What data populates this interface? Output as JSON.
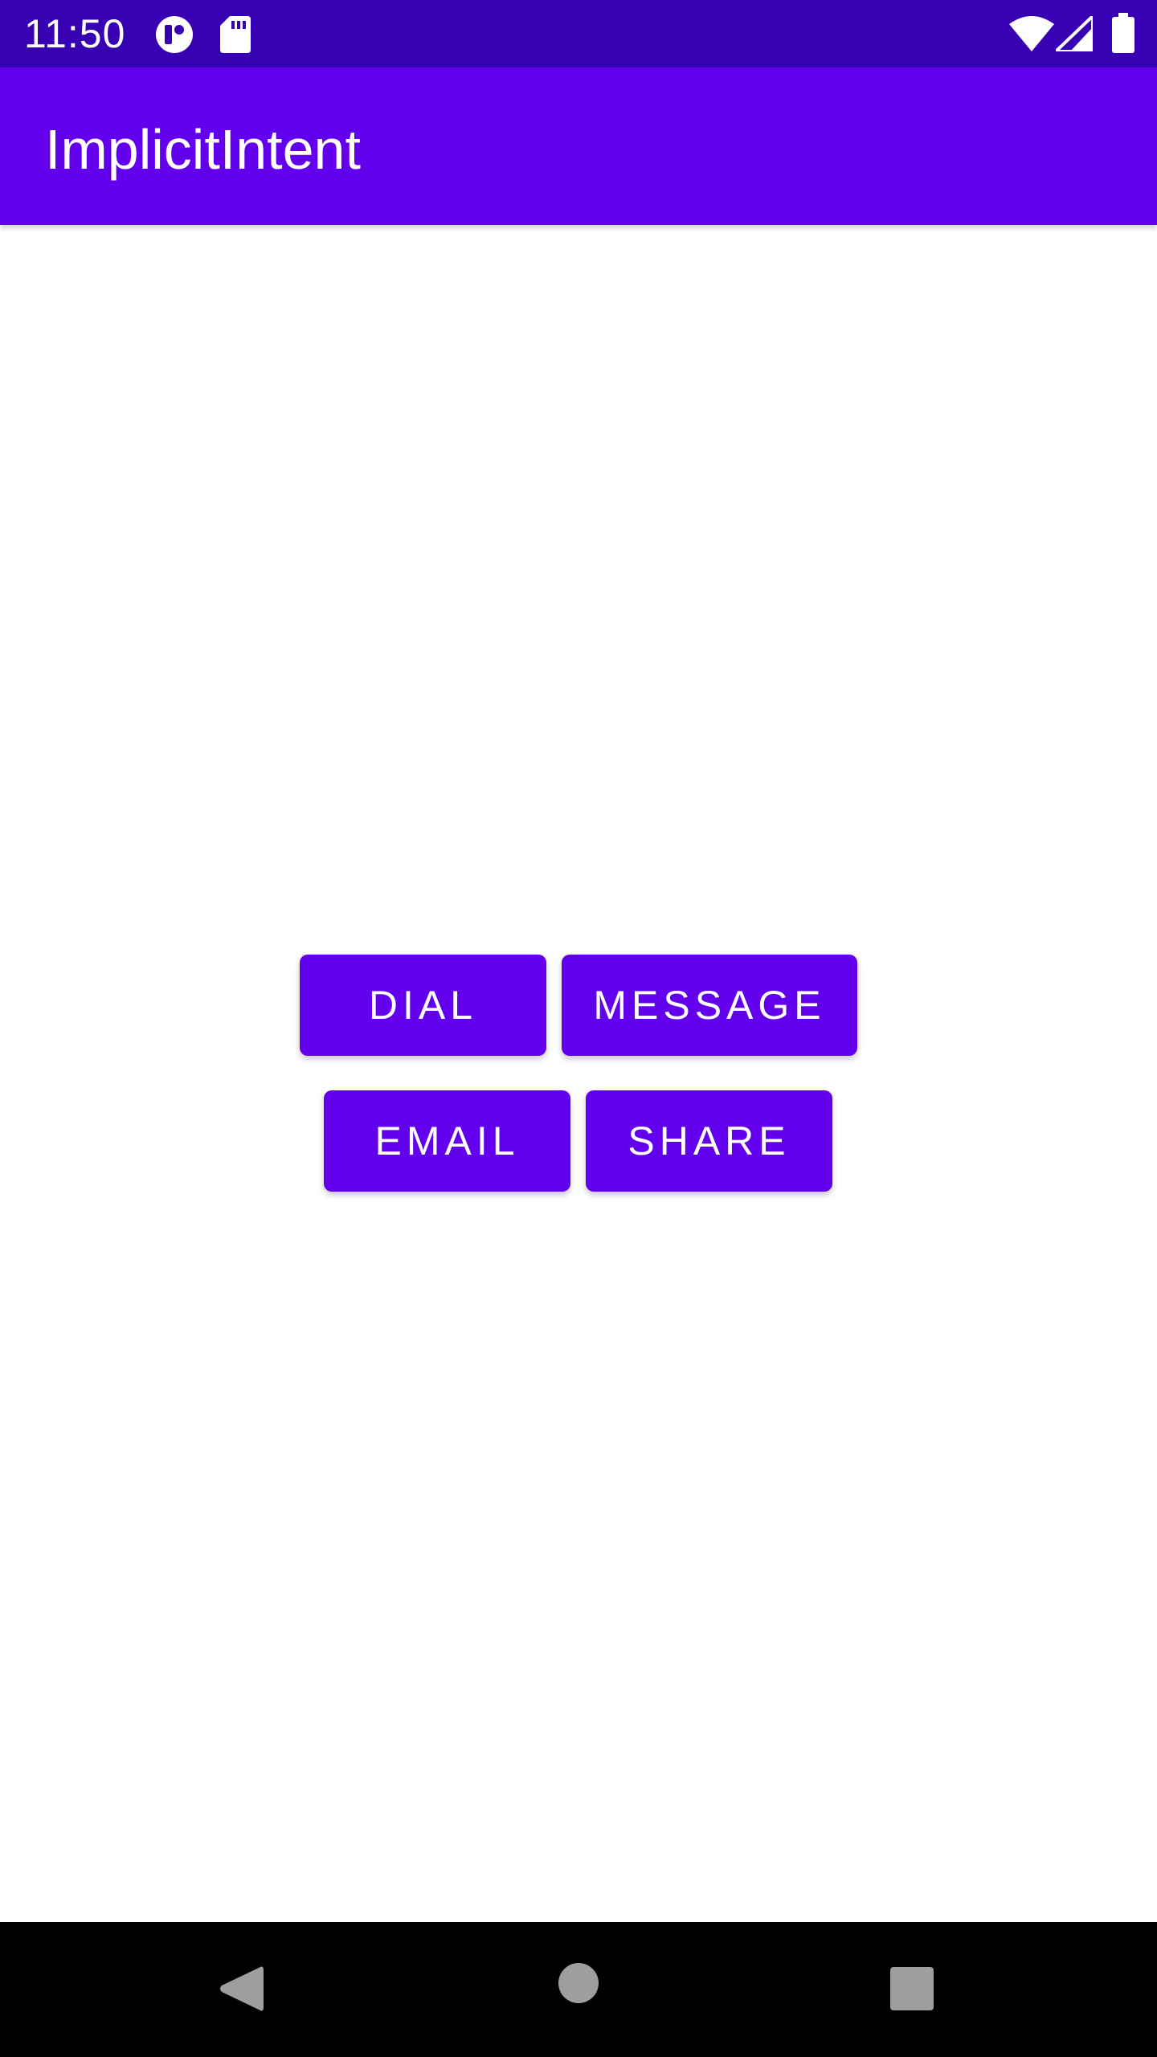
{
  "status_bar": {
    "time": "11:50",
    "icons": [
      "notification-app-icon",
      "sd-card-icon",
      "wifi-icon",
      "cell-signal-icon",
      "battery-icon"
    ]
  },
  "app_bar": {
    "title": "ImplicitIntent"
  },
  "buttons": {
    "dial": "DIAL",
    "message": "MESSAGE",
    "email": "EMAIL",
    "share": "SHARE"
  },
  "nav_bar": {
    "icons": [
      "back-icon",
      "home-icon",
      "recents-icon"
    ]
  },
  "colors": {
    "status_bar": "#3700b3",
    "primary": "#6200ee",
    "on_primary": "#ffffff",
    "background": "#ffffff",
    "nav_bar": "#000000",
    "nav_icon": "#9e9e9e"
  }
}
